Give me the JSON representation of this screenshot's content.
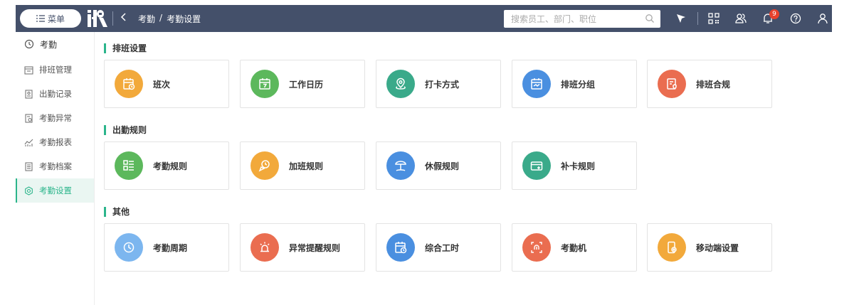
{
  "topbar": {
    "menu_label": "菜单",
    "logo_text": "i-R",
    "breadcrumb": [
      "考勤",
      "/",
      "考勤设置"
    ],
    "search_placeholder": "搜索员工、部门、职位",
    "notification_count": "9"
  },
  "sidebar": {
    "header": "考勤",
    "items": [
      {
        "label": "排班管理",
        "icon": "schedule-icon"
      },
      {
        "label": "出勤记录",
        "icon": "record-icon"
      },
      {
        "label": "考勤异常",
        "icon": "exception-icon"
      },
      {
        "label": "考勤报表",
        "icon": "report-icon"
      },
      {
        "label": "考勤档案",
        "icon": "archive-icon"
      },
      {
        "label": "考勤设置",
        "icon": "settings-icon",
        "active": true
      }
    ]
  },
  "sections": [
    {
      "title": "排班设置",
      "cards": [
        {
          "label": "班次",
          "color": "#f2a93b",
          "icon": "shift-calendar-icon"
        },
        {
          "label": "工作日历",
          "color": "#5cb85c",
          "icon": "work-calendar-icon"
        },
        {
          "label": "打卡方式",
          "color": "#3aaa8a",
          "icon": "location-pin-icon"
        },
        {
          "label": "排班分组",
          "color": "#4a8fe0",
          "icon": "group-calendar-icon"
        },
        {
          "label": "排班合规",
          "color": "#ea6d50",
          "icon": "compliance-icon"
        }
      ]
    },
    {
      "title": "出勤规则",
      "cards": [
        {
          "label": "考勤规则",
          "color": "#5cb85c",
          "icon": "rule-list-icon"
        },
        {
          "label": "加班规则",
          "color": "#f2a93b",
          "icon": "overtime-icon"
        },
        {
          "label": "休假规则",
          "color": "#4a8fe0",
          "icon": "beach-umbrella-icon"
        },
        {
          "label": "补卡规则",
          "color": "#3aaa8a",
          "icon": "card-add-icon"
        }
      ]
    },
    {
      "title": "其他",
      "cards": [
        {
          "label": "考勤周期",
          "color": "#7cb6ef",
          "icon": "clock-cycle-icon"
        },
        {
          "label": "异常提醒规则",
          "color": "#ea6d50",
          "icon": "alarm-light-icon"
        },
        {
          "label": "综合工时",
          "color": "#4a8fe0",
          "icon": "hours-calendar-icon"
        },
        {
          "label": "考勤机",
          "color": "#ea6d50",
          "icon": "fingerprint-icon"
        },
        {
          "label": "移动端设置",
          "color": "#f2a93b",
          "icon": "mobile-settings-icon"
        }
      ]
    }
  ]
}
